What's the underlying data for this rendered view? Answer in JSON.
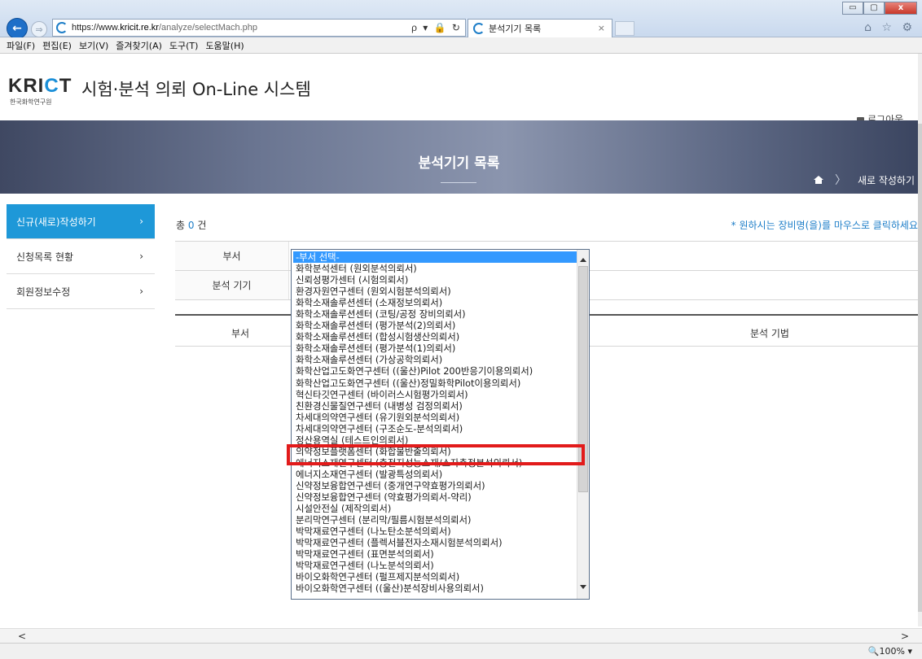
{
  "browser": {
    "url_prefix": "https://www.",
    "url_domain": "kricit.re.kr",
    "url_path": "/analyze/selectMach.php",
    "addr_tools": "ρ ▾ 🔒 ↻",
    "tab_title": "분석기기 목록",
    "tab_close": "×",
    "back_glyph": "←",
    "forward_glyph": "⇒",
    "win_min": "▭",
    "win_max": "▢",
    "win_close": "x",
    "corner_icons": "⌂ ☆ ⚙"
  },
  "menu": [
    "파일(F)",
    "편집(E)",
    "보기(V)",
    "즐겨찾기(A)",
    "도구(T)",
    "도움말(H)"
  ],
  "header": {
    "logo_text_a": "KRI",
    "logo_text_c": "C",
    "logo_text_b": "T",
    "logo_sub": "한국화학연구원",
    "site_title": "시험·분석 의뢰 On-Line 시스템",
    "logout": "로그아웃"
  },
  "banner": {
    "title": "분석기기 목록",
    "crumb_sep": "〉",
    "crumb": "새로 작성하기"
  },
  "sidebar": {
    "items": [
      {
        "label": "신규(새로)작성하기",
        "arrow": "›"
      },
      {
        "label": "신청목록 현황",
        "arrow": "›"
      },
      {
        "label": "회원정보수정",
        "arrow": "›"
      }
    ]
  },
  "main": {
    "count_prefix": "총 ",
    "count_value": "0",
    "count_suffix": " 건",
    "hint": "* 원하시는 장비명(을)를 마우스로 클릭하세요",
    "form_label_dept": "부서",
    "form_label_instrument": "분석 기기",
    "col_dept": "부서",
    "col_method": "분석 기법"
  },
  "dropdown": {
    "options": [
      "-부서 선택-",
      "화학분석센터 (원외분석의뢰서)",
      "신뢰성평가센터 (시험의뢰서)",
      "환경자원연구센터 (원외시험분석의뢰서)",
      "화학소재솔루션센터 (소재정보의뢰서)",
      "화학소재솔루션센터 (코팅/공정 장비의뢰서)",
      "화학소재솔루션센터 (평가분석(2)의뢰서)",
      "화학소재솔루션센터 (합성시험생산의뢰서)",
      "화학소재솔루션센터 (평가분석(1)의뢰서)",
      "화학소재솔루션센터 (가상공학의뢰서)",
      "화학산업고도화연구센터 ((울산)Pilot 200반응기이용의뢰서)",
      "화학산업고도화연구센터 ((울산)정밀화학Pilot이용의뢰서)",
      "혁신타깃연구센터 (바이러스시험평가의뢰서)",
      "친환경신물질연구센터 (내병성 검정의뢰서)",
      "차세대의약연구센터 (유기원외분석의뢰서)",
      "차세대의약연구센터 (구조순도-분석의뢰서)",
      "정산용역실 (테스트인의뢰서)",
      "의약정보플랫폼센터 (화합물반출의뢰서)",
      "에너지소재연구센터 (충전지성능소재/소자측정분석의뢰서)",
      "에너지소재연구센터 (발광특성의뢰서)",
      "신약정보융합연구센터 (중개연구약효평가의뢰서)",
      "신약정보융합연구센터 (약효평가의뢰서-약리)",
      "시설안전실 (제작의뢰서)",
      "분리막연구센터 (분리막/필름시험분석의뢰서)",
      "박막재료연구센터 (나노탄소분석의뢰서)",
      "박막재료연구센터 (플렉서블전자소재시험분석의뢰서)",
      "박막재료연구센터 (표면분석의뢰서)",
      "박막재료연구센터 (나노분석의뢰서)",
      "바이오화학연구센터 (펄프제지분석의뢰서)",
      "바이오화학연구센터 ((울산)분석장비사용의뢰서)"
    ]
  },
  "status": {
    "scroll_left": "<",
    "scroll_right": ">",
    "zoom": "🔍100%  ▾"
  }
}
